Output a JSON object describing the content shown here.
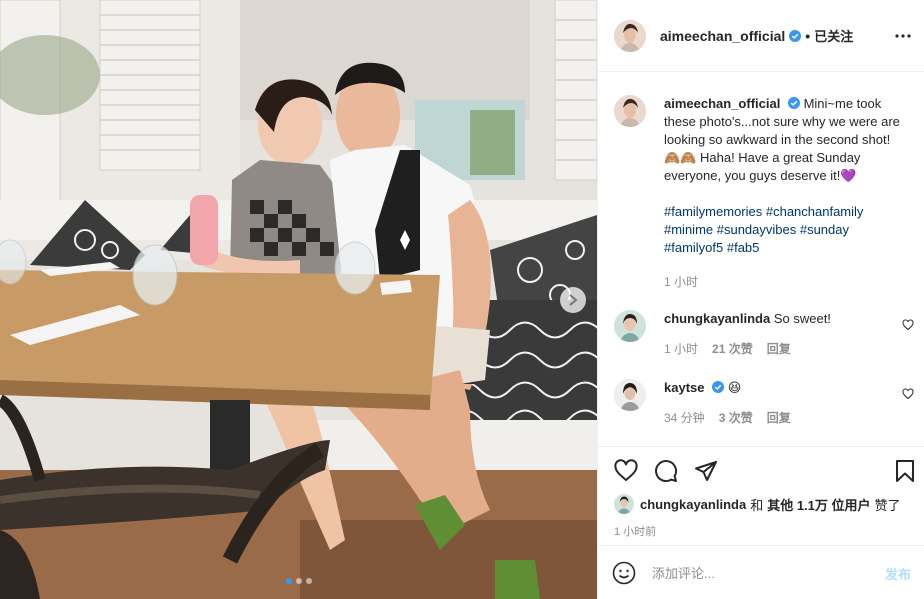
{
  "post": {
    "image_alt": "photo of a woman and a man sitting at a restaurant table",
    "carousel": {
      "count": 3,
      "active": 1
    }
  },
  "header": {
    "username": "aimeechan_official",
    "separator": "•",
    "follow_status": "已关注",
    "more_icon": "more-horizontal-icon"
  },
  "caption": {
    "username": "aimeechan_official",
    "text": "Mini~me took these photo's...not sure why we were are looking so awkward in the second shot! 🙈🙈 Haha! Have a great Sunday everyone, you guys deserve it!💜",
    "hashtags": "#familymemories #chanchanfamily #minime #sundayvibes #sunday #familyof5 #fab5",
    "time": "1 小时"
  },
  "comments": [
    {
      "username": "chungkayanlinda",
      "text": "So sweet!",
      "time": "1 小时",
      "likes": "21 次赞",
      "reply": "回复"
    },
    {
      "username": "kaytse",
      "text": "😆",
      "time": "34 分钟",
      "likes": "3 次赞",
      "reply": "回复"
    }
  ],
  "likes": {
    "username": "chungkayanlinda",
    "and": "和",
    "others": "其他 1.1万 位用户",
    "liked": "赞了"
  },
  "timestamp": "1 小时前",
  "add_comment": {
    "placeholder": "添加评论...",
    "post_label": "发布"
  },
  "colors": {
    "link": "#00376b",
    "verified": "#3897f0",
    "secondary_text": "#8e8e8e",
    "post_button": "#b2dffc",
    "carousel_active": "#2f9bf0"
  }
}
